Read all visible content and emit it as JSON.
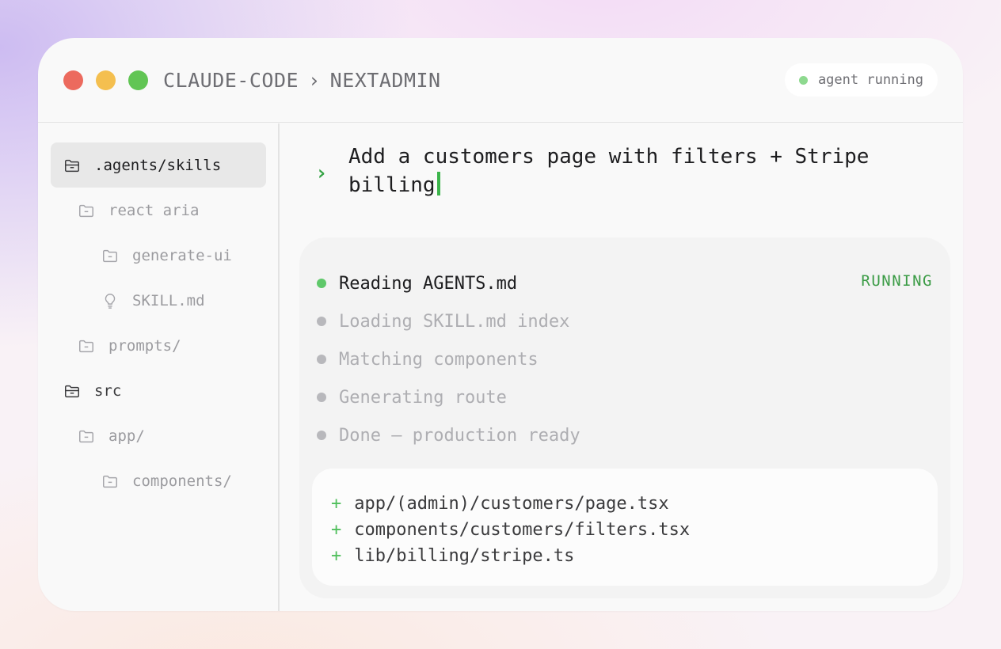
{
  "window": {
    "breadcrumb": [
      "CLAUDE-CODE",
      "NEXTADMIN"
    ],
    "breadcrumb_separator": "›",
    "status": "agent running"
  },
  "sidebar": {
    "items": [
      {
        "label": ".agents/skills",
        "icon": "folder-open-icon",
        "active": true
      },
      {
        "label": "react aria",
        "icon": "folder-icon"
      },
      {
        "label": "generate-ui",
        "icon": "folder-icon"
      },
      {
        "label": "SKILL.md",
        "icon": "lightbulb-icon"
      },
      {
        "label": "prompts/",
        "icon": "folder-icon"
      },
      {
        "label": "src",
        "icon": "folder-open-icon"
      },
      {
        "label": "app/",
        "icon": "folder-icon"
      },
      {
        "label": "components/",
        "icon": "folder-icon"
      }
    ]
  },
  "prompt": {
    "caret": "›",
    "text": "Add a customers page with filters + Stripe billing"
  },
  "steps": [
    {
      "label": "Reading AGENTS.md",
      "state": "running"
    },
    {
      "label": "Loading SKILL.md index",
      "state": "pending"
    },
    {
      "label": "Matching components",
      "state": "pending"
    },
    {
      "label": "Generating route",
      "state": "pending"
    },
    {
      "label": "Done — production ready",
      "state": "pending"
    }
  ],
  "running_badge": "RUNNING",
  "files": [
    {
      "marker": "+",
      "path": "app/(admin)/customers/page.tsx"
    },
    {
      "marker": "+",
      "path": "components/customers/filters.tsx"
    },
    {
      "marker": "+",
      "path": "lib/billing/stripe.ts"
    }
  ],
  "colors": {
    "accent_green": "#3a9b45",
    "traffic_red": "#ec6a5e",
    "traffic_yellow": "#f4bf4f",
    "traffic_green": "#61c554"
  }
}
